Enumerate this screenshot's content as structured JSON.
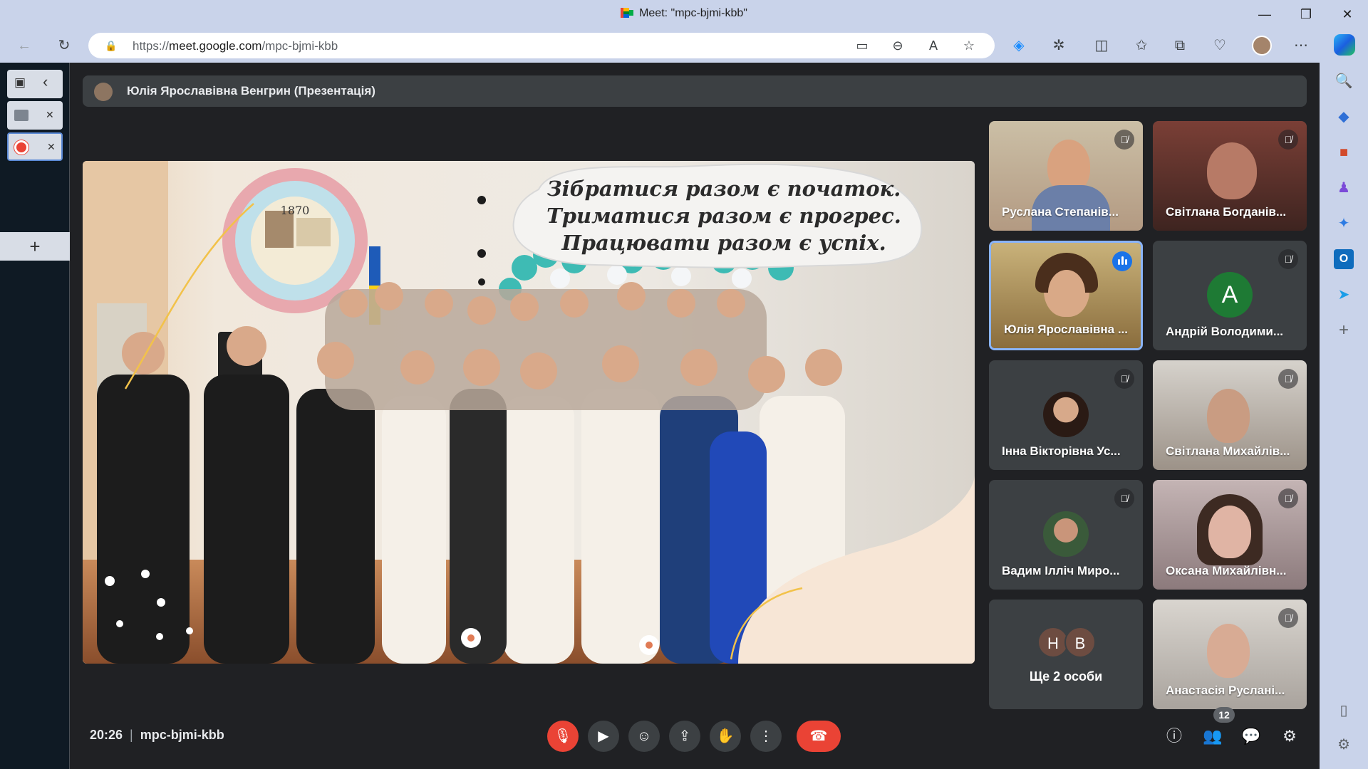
{
  "window": {
    "title": "Meet: \"mpc-bjmi-kbb\"",
    "minimize": "—",
    "maximize": "❐",
    "close": "✕"
  },
  "browser": {
    "url_prefix": "https://",
    "url_host": "meet.google.com",
    "url_path": "/mpc-bjmi-kbb",
    "nav": {
      "back": "←",
      "reload": "↻",
      "lock": "🔒"
    },
    "omnibox_icons": {
      "camera": "▭",
      "zoom": "⊖",
      "read_aloud": "A",
      "favorite": "☆"
    },
    "toolbar_icons": {
      "extension_1": "◈",
      "extensions": "✲",
      "split": "◫",
      "favorites": "✩",
      "collections": "⧉",
      "performance": "♡",
      "more": "⋯"
    }
  },
  "vertical_tabs": {
    "panel_toggle": "▣",
    "collapse": "‹",
    "tab1_close": "✕",
    "tab2_close": "✕",
    "add": "+"
  },
  "meet": {
    "presenter_label": "Юлія Ярославівна Венгрин (Презентація)",
    "slide_quote": [
      "Зібратися разом є початок.",
      "Триматися разом є прогрес.",
      "Працювати разом є успіх."
    ],
    "seal_year": "1870",
    "participants": [
      {
        "name": "Руслана Степанів...",
        "state": "muted"
      },
      {
        "name": "Світлана Богданів...",
        "state": "muted"
      },
      {
        "name": "Юлія Ярославівна ...",
        "state": "speaking"
      },
      {
        "name": "Андрій Володими...",
        "state": "muted",
        "avatar_letter": "A"
      },
      {
        "name": "Інна Вікторівна Ус...",
        "state": "muted"
      },
      {
        "name": "Світлана Михайлів...",
        "state": "muted"
      },
      {
        "name": "Вадим Ілліч Миро...",
        "state": "muted"
      },
      {
        "name": "Оксана Михайлівн...",
        "state": "muted"
      },
      {
        "name": "Анастасія Руслані...",
        "state": "muted"
      }
    ],
    "more": {
      "label": "Ще 2 особи",
      "avatars": [
        "H",
        "B"
      ]
    },
    "time": "20:26",
    "meeting_code": "mpc-bjmi-kbb",
    "participant_count": "12",
    "mute_icon": "🎙̸",
    "controls": {
      "mic": "🎙",
      "camera": "▶",
      "emoji": "☺",
      "present": "⇪",
      "hand": "✋",
      "more": "⋮",
      "hangup": "☎"
    },
    "right_controls": {
      "info": "ⓘ",
      "people": "👥",
      "chat": "💬",
      "activities": "⚙"
    }
  },
  "edge_sidebar": {
    "search": "🔍",
    "tag": "◆",
    "briefcase": "■",
    "games": "♟",
    "copilot": "✦",
    "outlook": "O",
    "send": "➤",
    "add": "+",
    "sidebar_toggle": "▯",
    "settings": "⚙"
  }
}
